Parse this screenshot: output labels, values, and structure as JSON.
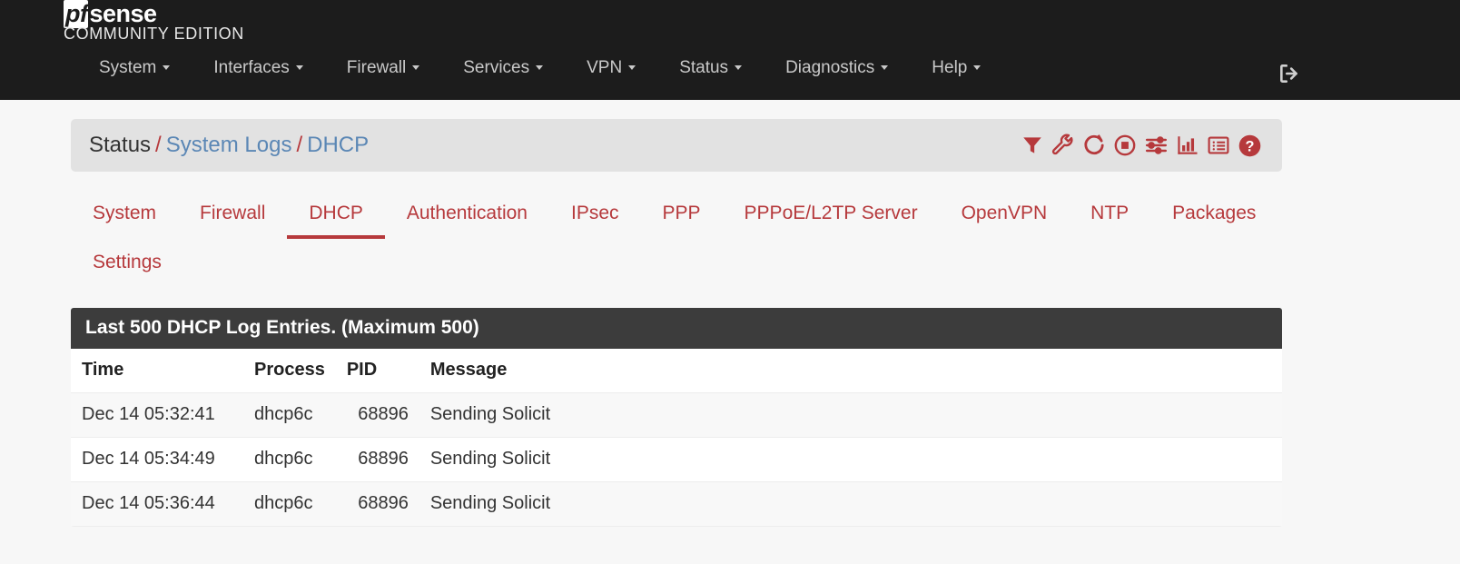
{
  "navbar": {
    "brand_pf": "pf",
    "brand_sense": "sense",
    "brand_subtitle": "COMMUNITY EDITION",
    "menu": [
      {
        "label": "System",
        "caret": true
      },
      {
        "label": "Interfaces",
        "caret": true
      },
      {
        "label": "Firewall",
        "caret": true
      },
      {
        "label": "Services",
        "caret": true
      },
      {
        "label": "VPN",
        "caret": true
      },
      {
        "label": "Status",
        "caret": true
      },
      {
        "label": "Diagnostics",
        "caret": true
      },
      {
        "label": "Help",
        "caret": true
      }
    ],
    "logout_icon": "sign-out-icon"
  },
  "breadcrumb": {
    "items": [
      {
        "label": "Status",
        "link": false
      },
      {
        "label": "System Logs",
        "link": true
      },
      {
        "label": "DHCP",
        "link": true
      }
    ],
    "separator": "/",
    "icons": [
      {
        "name": "filter-icon"
      },
      {
        "name": "wrench-icon"
      },
      {
        "name": "refresh-icon"
      },
      {
        "name": "pause-record-icon"
      },
      {
        "name": "sliders-icon"
      },
      {
        "name": "bar-chart-icon"
      },
      {
        "name": "list-icon"
      },
      {
        "name": "help-circle-icon"
      }
    ]
  },
  "tabs": [
    {
      "label": "System",
      "active": false
    },
    {
      "label": "Firewall",
      "active": false
    },
    {
      "label": "DHCP",
      "active": true
    },
    {
      "label": "Authentication",
      "active": false
    },
    {
      "label": "IPsec",
      "active": false
    },
    {
      "label": "PPP",
      "active": false
    },
    {
      "label": "PPPoE/L2TP Server",
      "active": false
    },
    {
      "label": "OpenVPN",
      "active": false
    },
    {
      "label": "NTP",
      "active": false
    },
    {
      "label": "Packages",
      "active": false
    },
    {
      "label": "Settings",
      "active": false
    }
  ],
  "panel": {
    "title": "Last 500 DHCP Log Entries. (Maximum 500)",
    "columns": [
      "Time",
      "Process",
      "PID",
      "Message"
    ],
    "rows": [
      {
        "time": "Dec 14 05:32:41",
        "process": "dhcp6c",
        "pid": "68896",
        "message": "Sending Solicit"
      },
      {
        "time": "Dec 14 05:34:49",
        "process": "dhcp6c",
        "pid": "68896",
        "message": "Sending Solicit"
      },
      {
        "time": "Dec 14 05:36:44",
        "process": "dhcp6c",
        "pid": "68896",
        "message": "Sending Solicit"
      }
    ]
  },
  "colors": {
    "navbar_bg": "#1c1c1c",
    "accent_red": "#b6393c",
    "link_blue": "#5b87b5",
    "panel_header_bg": "#3c3c3c",
    "page_bg": "#f7f7f7",
    "breadcrumb_bg": "#e2e2e2"
  }
}
